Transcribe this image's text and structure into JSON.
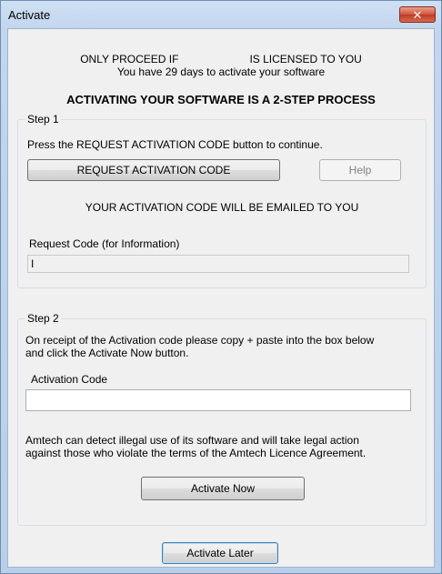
{
  "window": {
    "title": "Activate",
    "close_glyph": "✕"
  },
  "header": {
    "warning_prefix": "ONLY PROCEED IF",
    "warning_suffix": "IS LICENSED TO YOU",
    "days_notice": "You have 29 days to activate your software",
    "process_heading": "ACTIVATING YOUR SOFTWARE IS A 2-STEP PROCESS"
  },
  "step1": {
    "label": "Step 1",
    "instruction": "Press the REQUEST ACTIVATION CODE button to continue.",
    "request_button": "REQUEST ACTIVATION CODE",
    "help_button": "Help",
    "email_notice": "YOUR ACTIVATION CODE WILL BE EMAILED TO YOU",
    "request_code_label": "Request Code (for Information)",
    "request_code_value": "I"
  },
  "step2": {
    "label": "Step 2",
    "instruction_line1": "On receipt of the Activation code please copy + paste into the box below",
    "instruction_line2": "and click the Activate Now button.",
    "activation_code_label": "Activation Code",
    "activation_code_value": "",
    "legal_line1": "Amtech can detect illegal use of its software and will take legal action",
    "legal_line2": "against those who violate the terms of the Amtech Licence Agreement.",
    "activate_now_button": "Activate Now"
  },
  "footer": {
    "activate_later_button": "Activate Later"
  }
}
